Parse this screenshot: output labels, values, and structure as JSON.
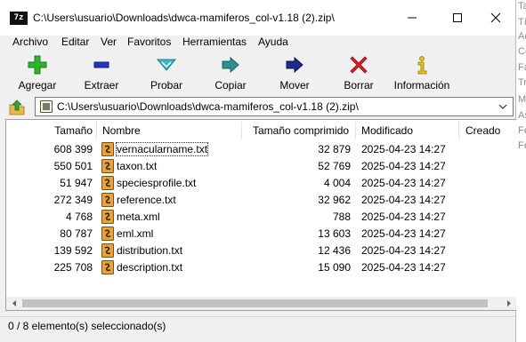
{
  "window": {
    "title": "C:\\Users\\usuario\\Downloads\\dwca-mamiferos_col-v1.18 (2).zip\\",
    "app_icon_text": "7z",
    "controls": {
      "minimize": "minimize",
      "maximize": "maximize",
      "close": "close"
    }
  },
  "menu": [
    "Archivo",
    "Editar",
    "Ver",
    "Favoritos",
    "Herramientas",
    "Ayuda"
  ],
  "toolbar": [
    {
      "label": "Agregar",
      "icon": "plus-icon",
      "color": "#2db32d"
    },
    {
      "label": "Extraer",
      "icon": "minus-icon",
      "color": "#1f36c7"
    },
    {
      "label": "Probar",
      "icon": "check-icon",
      "color": "#39b7c9"
    },
    {
      "label": "Copiar",
      "icon": "copy-arrow-icon",
      "color": "#2f8f8f"
    },
    {
      "label": "Mover",
      "icon": "move-arrow-icon",
      "color": "#1f2a8c"
    },
    {
      "label": "Borrar",
      "icon": "delete-x-icon",
      "color": "#d81f26"
    },
    {
      "label": "Información",
      "icon": "info-icon",
      "color": "#e6c417"
    }
  ],
  "address": {
    "path": "C:\\Users\\usuario\\Downloads\\dwca-mamiferos_col-v1.18 (2).zip\\"
  },
  "columns": [
    "Tamaño",
    "Nombre",
    "Tamaño comprimido",
    "Modificado",
    "Creado"
  ],
  "files": [
    {
      "size": "608 399",
      "name": "vernacularname.txt",
      "packed": "32 879",
      "modified": "2025-04-23 14:27",
      "created": ""
    },
    {
      "size": "550 501",
      "name": "taxon.txt",
      "packed": "52 769",
      "modified": "2025-04-23 14:27",
      "created": ""
    },
    {
      "size": "51 947",
      "name": "speciesprofile.txt",
      "packed": "4 004",
      "modified": "2025-04-23 14:27",
      "created": ""
    },
    {
      "size": "272 349",
      "name": "reference.txt",
      "packed": "32 962",
      "modified": "2025-04-23 14:27",
      "created": ""
    },
    {
      "size": "4 768",
      "name": "meta.xml",
      "packed": "788",
      "modified": "2025-04-23 14:27",
      "created": ""
    },
    {
      "size": "80 787",
      "name": "eml.xml",
      "packed": "13 603",
      "modified": "2025-04-23 14:27",
      "created": ""
    },
    {
      "size": "139 592",
      "name": "distribution.txt",
      "packed": "12 436",
      "modified": "2025-04-23 14:27",
      "created": ""
    },
    {
      "size": "225 708",
      "name": "description.txt",
      "packed": "15 090",
      "modified": "2025-04-23 14:27",
      "created": ""
    }
  ],
  "status": "0 / 8 elemento(s) seleccionado(s)",
  "background_fragments": [
    "Ta",
    "Tí",
    "Ac",
    "Co",
    "Fa",
    "Tr",
    "M",
    "As",
    "Fe",
    "Fe"
  ]
}
